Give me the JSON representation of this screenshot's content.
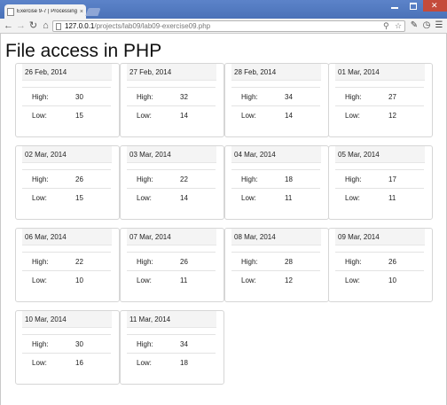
{
  "browser": {
    "tab_title": "Exercise 9-7 | Processing fil",
    "close_glyph": "×",
    "url_host": "127.0.0.1",
    "url_path": "/projects/lab09/lab09-exercise09.php"
  },
  "page": {
    "title": "File access in PHP",
    "high_label": "High:",
    "low_label": "Low:"
  },
  "forecast": [
    {
      "date": "26 Feb, 2014",
      "high": "30",
      "low": "15"
    },
    {
      "date": "27 Feb, 2014",
      "high": "32",
      "low": "14"
    },
    {
      "date": "28 Feb, 2014",
      "high": "34",
      "low": "14"
    },
    {
      "date": "01 Mar, 2014",
      "high": "27",
      "low": "12"
    },
    {
      "date": "02 Mar, 2014",
      "high": "26",
      "low": "15"
    },
    {
      "date": "03 Mar, 2014",
      "high": "22",
      "low": "14"
    },
    {
      "date": "04 Mar, 2014",
      "high": "18",
      "low": "11"
    },
    {
      "date": "05 Mar, 2014",
      "high": "17",
      "low": "11"
    },
    {
      "date": "06 Mar, 2014",
      "high": "22",
      "low": "10"
    },
    {
      "date": "07 Mar, 2014",
      "high": "26",
      "low": "11"
    },
    {
      "date": "08 Mar, 2014",
      "high": "28",
      "low": "12"
    },
    {
      "date": "09 Mar, 2014",
      "high": "26",
      "low": "10"
    },
    {
      "date": "10 Mar, 2014",
      "high": "30",
      "low": "16"
    },
    {
      "date": "11 Mar, 2014",
      "high": "34",
      "low": "18"
    }
  ],
  "colors": {
    "tabstrip": "#4a72b8",
    "close_button": "#c44b3b",
    "card_header": "#f4f4f4"
  }
}
